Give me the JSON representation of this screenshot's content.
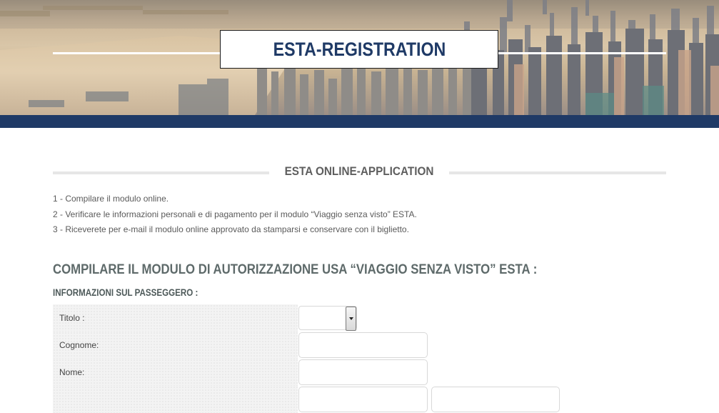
{
  "header": {
    "title": "ESTA-REGISTRATION"
  },
  "section": {
    "title": "ESTA ONLINE-APPLICATION"
  },
  "steps": [
    "1 - Compilare il modulo online.",
    "2 - Verificare le informazioni personali e di pagamento per il modulo “Viaggio senza visto” ESTA.",
    "3 - Riceverete per e-mail il modulo online approvato da stamparsi e conservare con il biglietto."
  ],
  "form": {
    "heading": "COMPILARE IL MODULO DI AUTORIZZAZIONE USA “VIAGGIO SENZA VISTO” ESTA :",
    "subheading": "INFORMAZIONI SUL PASSEGGERO :",
    "fields": {
      "titolo": {
        "label": "Titolo :",
        "value": ""
      },
      "cognome": {
        "label": "Cognome:",
        "value": ""
      },
      "nome": {
        "label": "Nome:",
        "value": ""
      }
    }
  },
  "colors": {
    "brand_blue": "#1f3a66",
    "heading_gray": "#5e6a6a"
  },
  "icons": {
    "select_arrow": "chevron-down-icon"
  }
}
